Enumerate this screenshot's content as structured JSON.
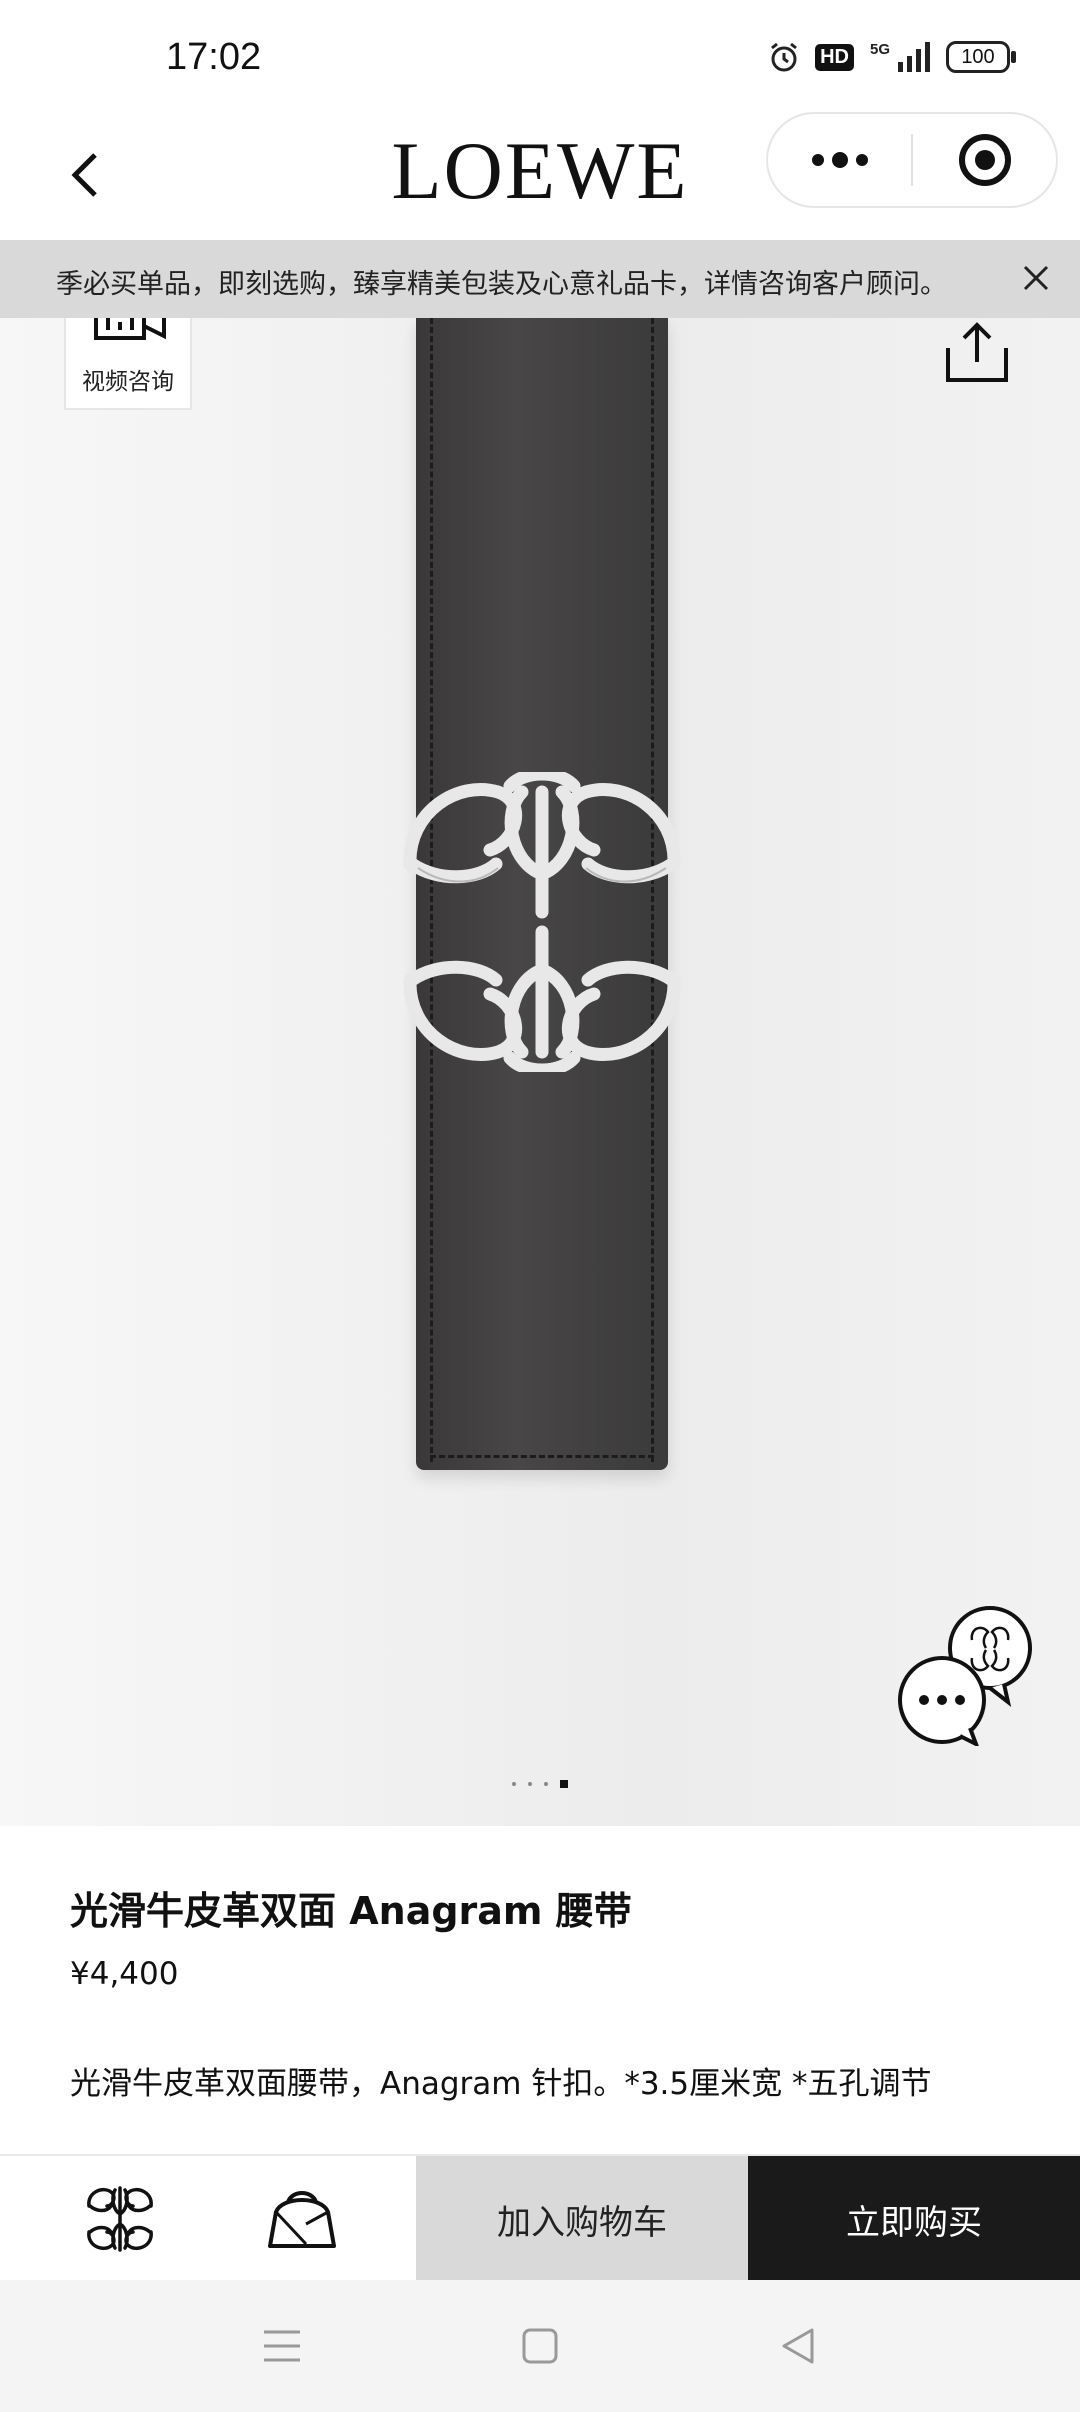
{
  "status_bar": {
    "time": "17:02",
    "icons": [
      "alarm-icon",
      "hd-icon",
      "5g-signal-icon",
      "battery-icon"
    ],
    "hd_label": "HD",
    "network_label": "5G",
    "battery_level": "100"
  },
  "header": {
    "brand": "LOEWE",
    "back_icon": "chevron-left-icon",
    "more_icon": "more-dots-icon",
    "close_icon": "target-circle-icon"
  },
  "notice": {
    "text": "季必买单品，即刻选购，臻享精美包装及心意礼品卡，详情咨询客户顾问。",
    "close_icon": "close-icon"
  },
  "gallery": {
    "video_consult_label": "视频咨询",
    "share_icon": "share-icon",
    "chat_icon": "chat-icon",
    "slide_count": 4,
    "active_slide": 4
  },
  "product": {
    "title": "光滑牛皮革双面 Anagram 腰带",
    "price": "¥4,400",
    "description": "光滑牛皮革双面腰带，Anagram 针扣。*3.5厘米宽 *五孔调节"
  },
  "actions": {
    "home_icon": "anagram-logo-icon",
    "bag_icon": "shopping-bag-icon",
    "add_to_cart": "加入购物车",
    "buy_now": "立即购买"
  },
  "system_nav": {
    "icons": [
      "menu-icon",
      "home-square-icon",
      "back-triangle-icon"
    ]
  },
  "colors": {
    "buy_button": "#1a1a1a",
    "cart_button": "#d9d9d9",
    "notice_bg": "#d9d9d9"
  }
}
